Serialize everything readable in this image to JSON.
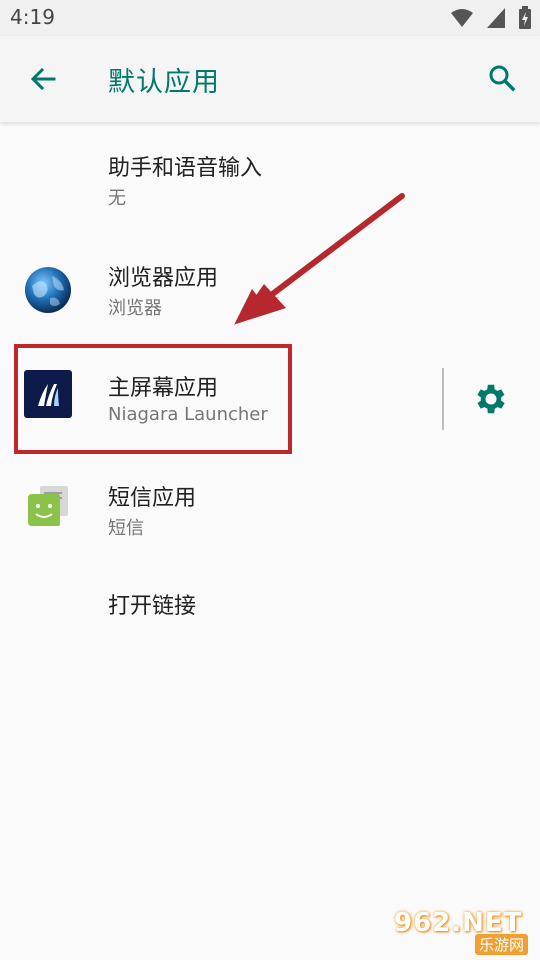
{
  "status_bar": {
    "time": "4:19"
  },
  "header": {
    "title": "默认应用"
  },
  "items": [
    {
      "title": "助手和语音输入",
      "subtitle": "无"
    },
    {
      "title": "浏览器应用",
      "subtitle": "浏览器"
    },
    {
      "title": "主屏幕应用",
      "subtitle": "Niagara Launcher"
    },
    {
      "title": "短信应用",
      "subtitle": "短信"
    },
    {
      "title": "打开链接"
    }
  ],
  "icons": {
    "back": "arrow-back-icon",
    "search": "search-icon",
    "settings": "gear-icon",
    "browser": "globe-icon",
    "launcher": "niagara-icon",
    "sms": "sms-robot-icon"
  },
  "colors": {
    "accent": "#00796b",
    "highlight": "#c0272d",
    "background": "#fafafa"
  },
  "watermark": {
    "text": "962.NET",
    "sub": "乐游网"
  }
}
